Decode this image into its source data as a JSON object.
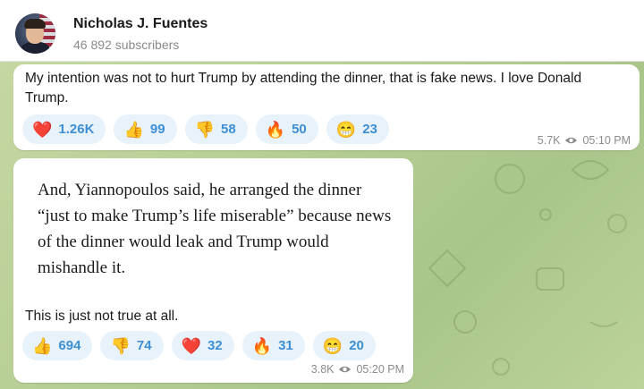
{
  "channel": {
    "name": "Nicholas J. Fuentes",
    "subscribers": "46 892 subscribers"
  },
  "messages": [
    {
      "text": "My intention was not to hurt Trump by attending the dinner, that is fake news. I love Donald Trump.",
      "reactions": [
        {
          "emoji": "❤️",
          "icon": "heart-icon",
          "count": "1.26K"
        },
        {
          "emoji": "👍",
          "icon": "thumbs-up-icon",
          "count": "99"
        },
        {
          "emoji": "👎",
          "icon": "thumbs-down-icon",
          "count": "58"
        },
        {
          "emoji": "🔥",
          "icon": "fire-icon",
          "count": "50"
        },
        {
          "emoji": "😁",
          "icon": "grin-icon",
          "count": "23"
        }
      ],
      "views": "5.7K",
      "time": "05:10 PM"
    },
    {
      "quote": "And, Yiannopoulos said, he arranged the dinner “just to make Trump’s life miserable” because news of the dinner would leak and Trump would mishandle it.",
      "text": "This is just not true at all.",
      "reactions": [
        {
          "emoji": "👍",
          "icon": "thumbs-up-icon",
          "count": "694"
        },
        {
          "emoji": "👎",
          "icon": "thumbs-down-icon",
          "count": "74"
        },
        {
          "emoji": "❤️",
          "icon": "heart-icon",
          "count": "32"
        },
        {
          "emoji": "🔥",
          "icon": "fire-icon",
          "count": "31"
        },
        {
          "emoji": "😁",
          "icon": "grin-icon",
          "count": "20"
        }
      ],
      "views": "3.8K",
      "time": "05:20 PM"
    }
  ],
  "colors": {
    "reaction_bg": "#e8f2fb",
    "reaction_count": "#3d8fd4",
    "meta_text": "#8b8b8b"
  }
}
